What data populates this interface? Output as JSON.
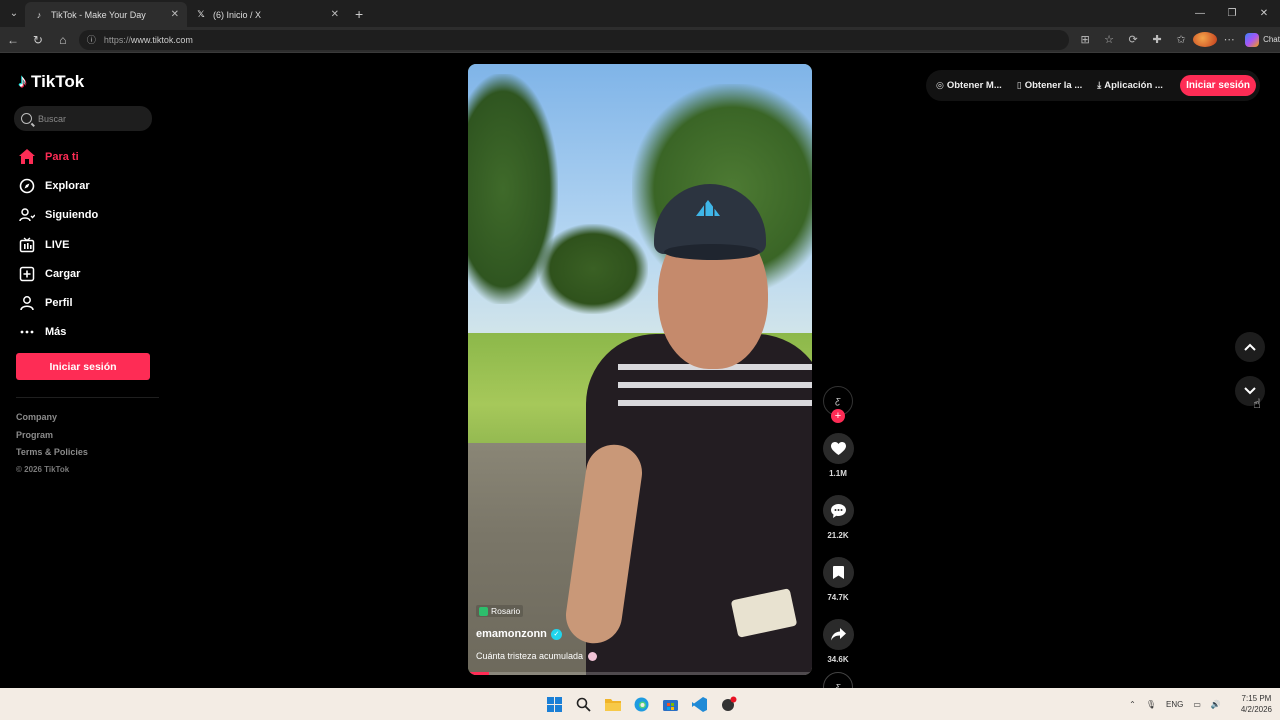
{
  "browser": {
    "tabs": [
      {
        "title": "TikTok - Make Your Day",
        "active": true,
        "icon": "tiktok-icon"
      },
      {
        "title": "(6) Inicio / X",
        "active": false,
        "icon": "x-icon"
      }
    ],
    "url_scheme": "https://",
    "url_host": "www.tiktok.com",
    "chat_label": "Chat"
  },
  "sidebar": {
    "brand": "TikTok",
    "search_placeholder": "Buscar",
    "nav": [
      {
        "label": "Para ti",
        "icon": "home-icon",
        "active": true
      },
      {
        "label": "Explorar",
        "icon": "compass-icon",
        "active": false
      },
      {
        "label": "Siguiendo",
        "icon": "person-follow-icon",
        "active": false
      },
      {
        "label": "LIVE",
        "icon": "live-tv-icon",
        "active": false
      },
      {
        "label": "Cargar",
        "icon": "upload-plus-icon",
        "active": false
      },
      {
        "label": "Perfil",
        "icon": "person-icon",
        "active": false
      },
      {
        "label": "Más",
        "icon": "more-dots-icon",
        "active": false
      }
    ],
    "login_label": "Iniciar sesión",
    "footer": {
      "links": [
        "Company",
        "Program",
        "Terms & Policies"
      ],
      "copyright": "© 2026 TikTok"
    }
  },
  "video": {
    "location": "Rosario",
    "author": "emamonzonn",
    "caption": "Cuánta tristeza acumulada",
    "progress_fraction": 0.06,
    "actions": [
      {
        "name": "like",
        "icon": "heart-icon",
        "count": "1.1M"
      },
      {
        "name": "comment",
        "icon": "comment-icon",
        "count": "21.2K"
      },
      {
        "name": "save",
        "icon": "bookmark-icon",
        "count": "74.7K"
      },
      {
        "name": "share",
        "icon": "share-arrow-icon",
        "count": "34.6K"
      }
    ]
  },
  "topbar": {
    "items": [
      {
        "label": "Obtener M...",
        "icon": "coin-icon"
      },
      {
        "label": "Obtener la ...",
        "icon": "phone-icon"
      },
      {
        "label": "Aplicación ...",
        "icon": "download-icon"
      }
    ],
    "login_label": "Iniciar sesión"
  },
  "taskbar": {
    "lang": "ENG",
    "time": "7:15 PM",
    "date": "4/2/2026"
  },
  "colors": {
    "accent": "#fe2c55",
    "background": "#000000"
  }
}
